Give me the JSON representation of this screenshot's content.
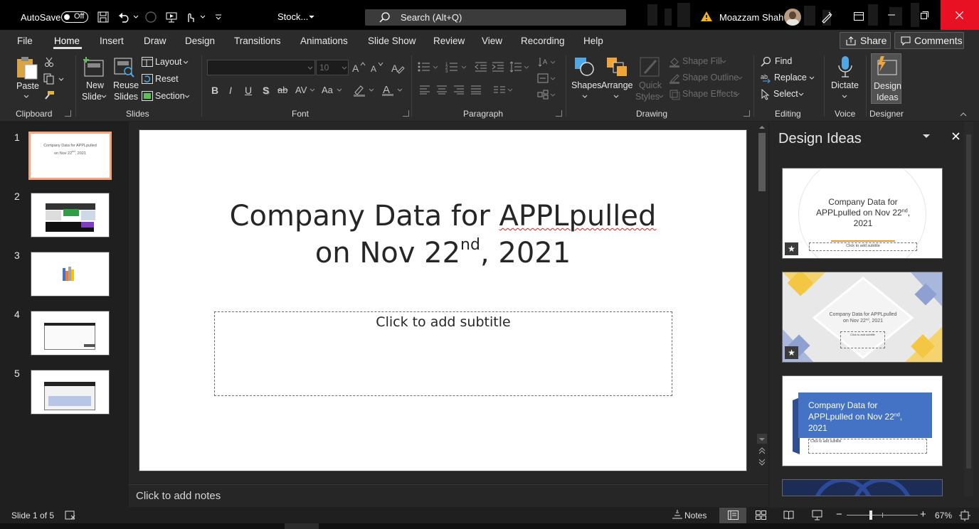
{
  "titlebar": {
    "autosave_label": "AutoSave",
    "autosave_state": "Off",
    "document_title": "Stock...",
    "search_placeholder": "Search (Alt+Q)",
    "user_name": "Moazzam Shah",
    "close_color": "#e81123"
  },
  "tabs": [
    "File",
    "Home",
    "Insert",
    "Draw",
    "Design",
    "Transitions",
    "Animations",
    "Slide Show",
    "Review",
    "View",
    "Recording",
    "Help"
  ],
  "active_tab": "Home",
  "top_buttons": {
    "share": "Share",
    "comments": "Comments"
  },
  "ribbon": {
    "clipboard": {
      "paste": "Paste",
      "group": "Clipboard"
    },
    "slides": {
      "new_slide_1": "New",
      "new_slide_2": "Slide",
      "reuse_1": "Reuse",
      "reuse_2": "Slides",
      "layout": "Layout",
      "reset": "Reset",
      "section": "Section",
      "group": "Slides"
    },
    "font": {
      "name": "",
      "size": "10",
      "group": "Font",
      "bold": "B",
      "italic": "I",
      "underline": "U",
      "shadow": "S",
      "strike": "ab",
      "spacing": "AV",
      "case": "Aa"
    },
    "paragraph": {
      "group": "Paragraph"
    },
    "drawing": {
      "shapes": "Shapes",
      "arrange": "Arrange",
      "quick_1": "Quick",
      "quick_2": "Styles",
      "shape_fill": "Shape Fill",
      "shape_outline": "Shape Outline",
      "shape_effects": "Shape Effects",
      "group": "Drawing"
    },
    "editing": {
      "find": "Find",
      "replace": "Replace",
      "select": "Select",
      "group": "Editing"
    },
    "voice": {
      "dictate": "Dictate",
      "group": "Voice"
    },
    "designer": {
      "ideas_1": "Design",
      "ideas_2": "Ideas",
      "group": "Designer"
    }
  },
  "slide_numbers": [
    "1",
    "2",
    "3",
    "4",
    "5"
  ],
  "slide": {
    "title_line1_a": "Company Data for ",
    "title_line1_b": "APPLpulled",
    "title_line2_a": "on Nov 22",
    "title_line2_sup": "nd",
    "title_line2_b": ", 2021",
    "subtitle_placeholder": "Click to add subtitle"
  },
  "notes_placeholder": "Click to add notes",
  "design_pane": {
    "title": "Design Ideas",
    "card1": {
      "line1": "Company Data for",
      "line2": "APPLpulled on Nov 22",
      "sup": "nd",
      "line2_end": ",",
      "line3": "2021",
      "sub": "Click to add subtitle"
    },
    "card2": {
      "line1": "Company Data for APPLpulled",
      "line2": "on Nov 22",
      "sup": "nd",
      "line2_end": ", 2021",
      "sub": "Click to add subtitle"
    },
    "card3": {
      "line1": "Company Data for",
      "line2": "APPLpulled on Nov 22",
      "sup": "nd",
      "line2_end": ",",
      "line3": "2021",
      "sub": "Click to add subtitle"
    }
  },
  "status": {
    "slide_info": "Slide 1 of 5",
    "notes": "Notes",
    "zoom": "67%",
    "zoom_fraction": 0.34
  }
}
